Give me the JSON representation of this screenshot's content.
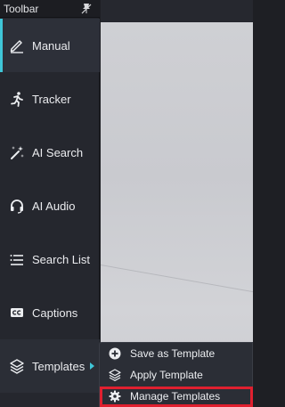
{
  "toolbar": {
    "title": "Toolbar",
    "items": [
      {
        "label": "Manual",
        "icon": "pencil-icon"
      },
      {
        "label": "Tracker",
        "icon": "running-person-icon"
      },
      {
        "label": "AI Search",
        "icon": "magic-wand-icon"
      },
      {
        "label": "AI Audio",
        "icon": "headphones-icon"
      },
      {
        "label": "Search List",
        "icon": "list-icon"
      },
      {
        "label": "Captions",
        "icon": "closed-captions-icon"
      },
      {
        "label": "Templates",
        "icon": "layers-icon"
      }
    ]
  },
  "submenu": {
    "items": [
      {
        "label": "Save as Template",
        "icon": "plus-circle-icon"
      },
      {
        "label": "Apply Template",
        "icon": "layers-icon"
      },
      {
        "label": "Manage Templates",
        "icon": "gear-icon"
      }
    ]
  },
  "colors": {
    "accent": "#3fc6d8",
    "highlight": "#e0202f"
  }
}
